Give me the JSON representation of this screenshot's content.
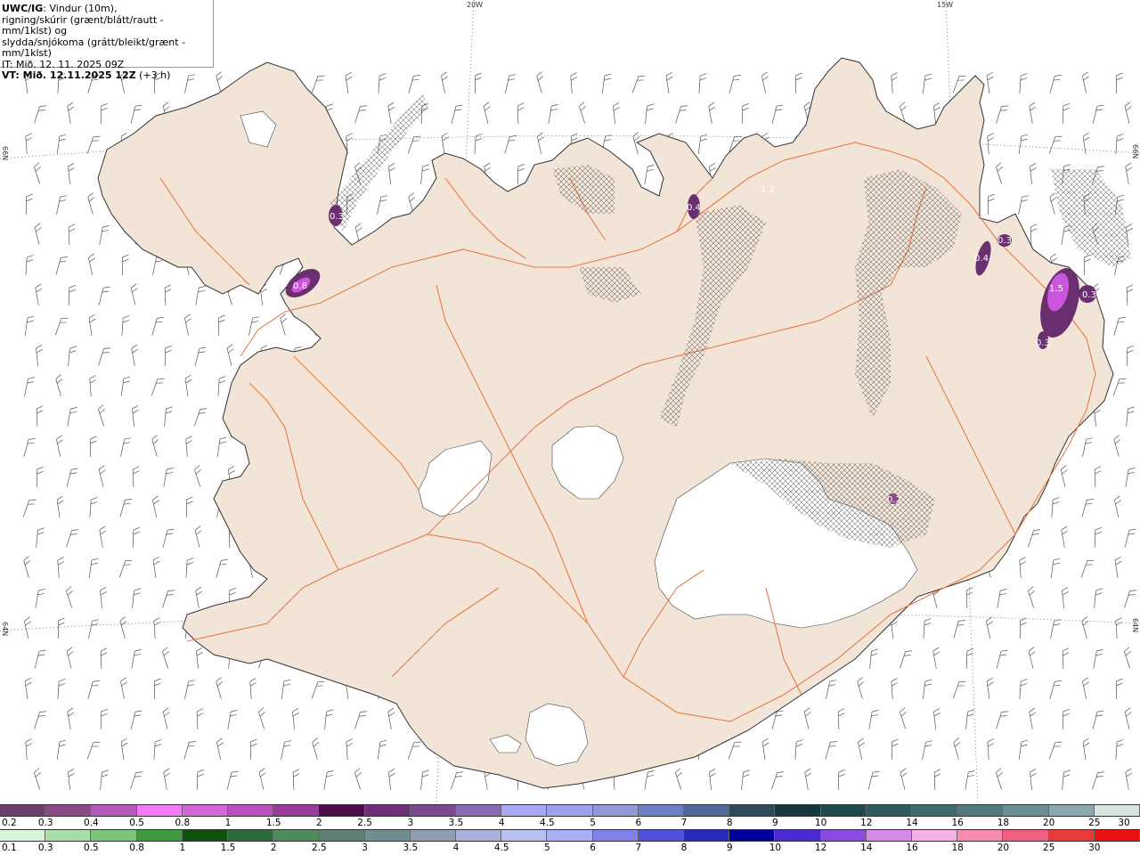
{
  "title": {
    "model": "UWC/IG",
    "desc1": ": Vindur (10m),",
    "desc2": "rigning/skúrir (grænt/blátt/rautt - mm/1klst) og",
    "desc3": "slydda/snjókoma (grátt/bleikt/grænt - mm/1klst)",
    "it": "IT: Mið. 12. 11. 2025 09Z",
    "vt": "VT: Mið. 12.11.2025 12Z",
    "vt_offset": " (+3 h)"
  },
  "coords": {
    "top_20w": "20W",
    "top_15w": "15W",
    "left_66": "66N",
    "right_66": "66N",
    "left_64": "64N",
    "right_64": "64N"
  },
  "precip_labels": [
    "0.3",
    "0.8",
    "0.4",
    "1.2",
    "0.3",
    "0.4",
    "1.5",
    "0.3",
    "0.3",
    "0.2"
  ],
  "colors": {
    "land": "#f2e4d7",
    "road": "#e87a4a",
    "coast": "#333333",
    "glacier": "#ffffff",
    "snow_purple": "#6a2f6e",
    "snow_magenta": "#cc55dd"
  },
  "legend_snow": {
    "labels": [
      "0.2",
      "0.3",
      "0.4",
      "0.5",
      "0.8",
      "1",
      "1.5",
      "2",
      "2.5",
      "3",
      "3.5",
      "4",
      "4.5",
      "5",
      "6",
      "7",
      "8",
      "9",
      "10",
      "12",
      "14",
      "16",
      "18",
      "20",
      "25",
      "30"
    ],
    "colors": [
      "#6e3f6a",
      "#8a4a87",
      "#b35ab8",
      "#f27af5",
      "#d566d8",
      "#b94fbf",
      "#9a3c9c",
      "#4a0e4a",
      "#6e2f78",
      "#7b4a8f",
      "#8a6ab0",
      "#a8a8f0",
      "#9aa4e8",
      "#8f9ad8",
      "#6f80c0",
      "#4e6a9a",
      "#2f4a5a",
      "#15383d",
      "#1f4a50",
      "#2f5a5f",
      "#3f6a70",
      "#507a80",
      "#6a8f95",
      "#8aa8ac",
      "#d8e4e4"
    ]
  },
  "legend_rain": {
    "labels": [
      "0.1",
      "0.3",
      "0.5",
      "0.8",
      "1",
      "1.5",
      "2",
      "2.5",
      "3",
      "3.5",
      "4",
      "4.5",
      "5",
      "6",
      "7",
      "8",
      "9",
      "10",
      "12",
      "14",
      "16",
      "18",
      "20",
      "25",
      "30"
    ],
    "colors": [
      "#d8f5d8",
      "#a8dca8",
      "#7cc47c",
      "#3f9a3f",
      "#0f4f0f",
      "#2f6a3f",
      "#4f8a5f",
      "#5f7f74",
      "#6f8f8f",
      "#8f9faf",
      "#a8b0d8",
      "#b8c0f0",
      "#a8b0f5",
      "#8080e8",
      "#5050d8",
      "#2a2ab8",
      "#00009a",
      "#4a2ad0",
      "#8a4ae0",
      "#d58ae8",
      "#f5b0e8",
      "#f58ab0",
      "#f06080",
      "#e83a3a",
      "#e81010"
    ]
  }
}
